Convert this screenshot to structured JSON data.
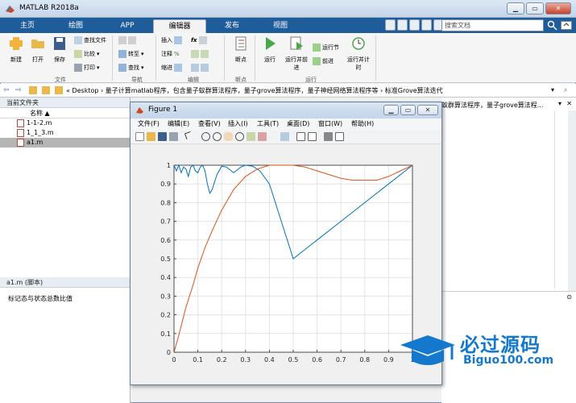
{
  "app": {
    "title": "MATLAB R2018a"
  },
  "window_buttons": {
    "minimize": "▁",
    "maximize": "▭",
    "close": "✕"
  },
  "tabs": [
    {
      "label": "主页"
    },
    {
      "label": "绘图"
    },
    {
      "label": "APP"
    },
    {
      "label": "编辑器",
      "active": true
    },
    {
      "label": "发布"
    },
    {
      "label": "视图"
    }
  ],
  "search": {
    "placeholder": "搜索文档"
  },
  "ribbon": {
    "file": {
      "label": "文件",
      "new": "新建",
      "open": "打开",
      "save": "保存",
      "find_files": "查找文件",
      "compare": "比较",
      "print": "打印"
    },
    "navigate": {
      "label": "导航",
      "goto": "转至",
      "find": "查找"
    },
    "edit": {
      "label": "编辑",
      "insert": "插入",
      "comment": "注释",
      "indent": "缩进"
    },
    "breakpoints": {
      "label": "断点",
      "breakpoints": "断点"
    },
    "run": {
      "label": "运行",
      "run": "运行",
      "run_advance": "运行并前进",
      "run_section": "运行节",
      "advance": "前进",
      "run_time": "运行并计时"
    }
  },
  "address": {
    "path": "« Desktop › 量子计算matlab程序，包含量子蚁群算法程序，量子grove算法程序，量子神经网络算法程序等 › 标准Grove算法迭代",
    "right_text": "蚁群算法程序，量子grove算法程..."
  },
  "current_folder": {
    "title": "当前文件夹",
    "col_name": "名称 ▲",
    "files": [
      {
        "name": "1-1-2.m",
        "selected": false
      },
      {
        "name": "1_1_3.m",
        "selected": false
      },
      {
        "name": "a1.m",
        "selected": true
      }
    ]
  },
  "details": {
    "title": "a1.m  (脚本)",
    "text": "标记态与状态总数比值"
  },
  "figure": {
    "title": "Figure 1",
    "menus": [
      "文件(F)",
      "编辑(E)",
      "查看(V)",
      "插入(I)",
      "工具(T)",
      "桌面(D)",
      "窗口(W)",
      "帮助(H)"
    ]
  },
  "chart_data": {
    "type": "line",
    "title": "",
    "xlabel": "",
    "ylabel": "",
    "xlim": [
      0,
      1
    ],
    "ylim": [
      0,
      1
    ],
    "grid": true,
    "xticks": [
      "0",
      "0.1",
      "0.2",
      "0.3",
      "0.4",
      "0.5",
      "0.6",
      "0.7",
      "0.8",
      "0.9",
      "1"
    ],
    "yticks": [
      "0",
      "0.1",
      "0.2",
      "0.3",
      "0.4",
      "0.5",
      "0.6",
      "0.7",
      "0.8",
      "0.9",
      "1"
    ],
    "series": [
      {
        "color": "#0072bd",
        "x": [
          0,
          0.01,
          0.02,
          0.03,
          0.04,
          0.05,
          0.06,
          0.07,
          0.08,
          0.09,
          0.1,
          0.11,
          0.12,
          0.13,
          0.14,
          0.15,
          0.16,
          0.18,
          0.2,
          0.22,
          0.25,
          0.28,
          0.3,
          0.33,
          0.36,
          0.4,
          0.45,
          0.5,
          0.55,
          0.6,
          0.7,
          0.8,
          0.9,
          1.0
        ],
        "y": [
          1,
          0.97,
          1,
          0.96,
          0.99,
          0.98,
          0.94,
          0.99,
          1,
          0.97,
          0.96,
          0.99,
          1,
          0.97,
          0.9,
          0.85,
          0.87,
          0.95,
          0.995,
          0.99,
          0.96,
          0.99,
          1,
          0.995,
          0.97,
          0.9,
          0.7,
          0.5,
          0.55,
          0.6,
          0.7,
          0.8,
          0.9,
          1.0
        ]
      },
      {
        "color": "#d95319",
        "x": [
          0,
          0.02,
          0.05,
          0.08,
          0.1,
          0.13,
          0.16,
          0.2,
          0.25,
          0.3,
          0.35,
          0.4,
          0.45,
          0.5,
          0.55,
          0.6,
          0.65,
          0.7,
          0.75,
          0.8,
          0.85,
          0.9,
          0.95,
          1.0
        ],
        "y": [
          0,
          0.09,
          0.24,
          0.36,
          0.45,
          0.56,
          0.65,
          0.76,
          0.87,
          0.94,
          0.98,
          1.0,
          1.0,
          1.0,
          0.99,
          0.97,
          0.95,
          0.93,
          0.92,
          0.92,
          0.92,
          0.94,
          0.97,
          1.0
        ]
      }
    ]
  },
  "watermark": {
    "title": "必过源码",
    "url": "Biguo100.com"
  },
  "colors": {
    "tabbar": "#1e5c9a",
    "series1": "#0072bd",
    "series2": "#d95319",
    "watermark": "#1478cc"
  }
}
